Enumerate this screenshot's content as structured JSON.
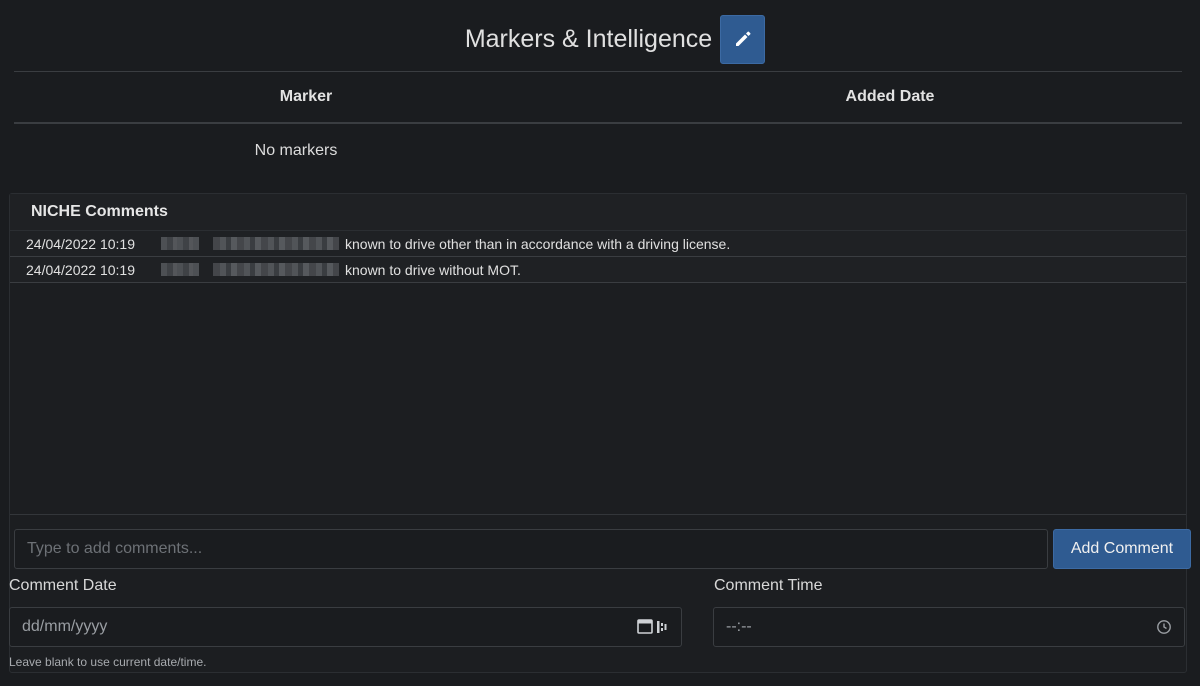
{
  "header": {
    "title": "Markers & Intelligence",
    "edit_icon": "pencil-icon"
  },
  "markers": {
    "columns": [
      "Marker",
      "Added Date"
    ],
    "empty_text": "No markers"
  },
  "comments": {
    "title": "NICHE Comments",
    "rows": [
      {
        "date": "24/04/2022 10:19",
        "text": "known to drive other than in accordance with a driving license."
      },
      {
        "date": "24/04/2022 10:19",
        "text": "known to drive without MOT."
      }
    ],
    "input_placeholder": "Type to add comments...",
    "add_button": "Add Comment",
    "date_label": "Comment Date",
    "date_placeholder": "dd/mm/yyyy",
    "time_label": "Comment Time",
    "time_placeholder": "--:--",
    "hint": "Leave blank to use current date/time."
  },
  "colors": {
    "background": "#1a1c1f",
    "accent": "#2f5b91",
    "border": "#3a3d41"
  }
}
